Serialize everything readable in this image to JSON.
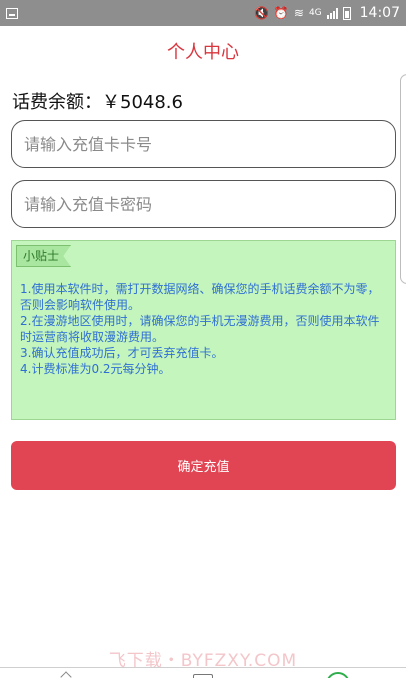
{
  "status_bar": {
    "time": "14:07",
    "network": "4G"
  },
  "header": {
    "title": "个人中心"
  },
  "balance": {
    "text": "话费余额：￥5048.6"
  },
  "form": {
    "card_number_placeholder": "请输入充值卡卡号",
    "card_number_value": "",
    "card_password_placeholder": "请输入充值卡密码",
    "card_password_value": ""
  },
  "tips": {
    "tag": "小贴士",
    "items": [
      "1.使用本软件时，需打开数据网络、确保您的手机话费余额不为零，否则会影响软件使用。",
      "2.在漫游地区使用时，请确保您的手机无漫游费用，否则使用本软件时运营商将收取漫游费用。",
      "3.确认充值成功后，才可丢弃充值卡。",
      "4.计费标准为0.2元每分钟。"
    ]
  },
  "confirm": {
    "label": "确定充值"
  },
  "watermark": {
    "text": "飞下载・BYFZXY.COM"
  },
  "colors": {
    "title_red": "#d9363e",
    "button_red": "#e14553",
    "tips_green_bg": "#c4f5bc",
    "tips_text_blue": "#2f6fd3",
    "status_bar_gray": "#8e8e8e"
  },
  "icons": {
    "status_left": "screenshot-icon",
    "nav_back": "back-chevron-icon",
    "nav_home": "home-square-icon",
    "nav_app": "app-circle-icon"
  }
}
